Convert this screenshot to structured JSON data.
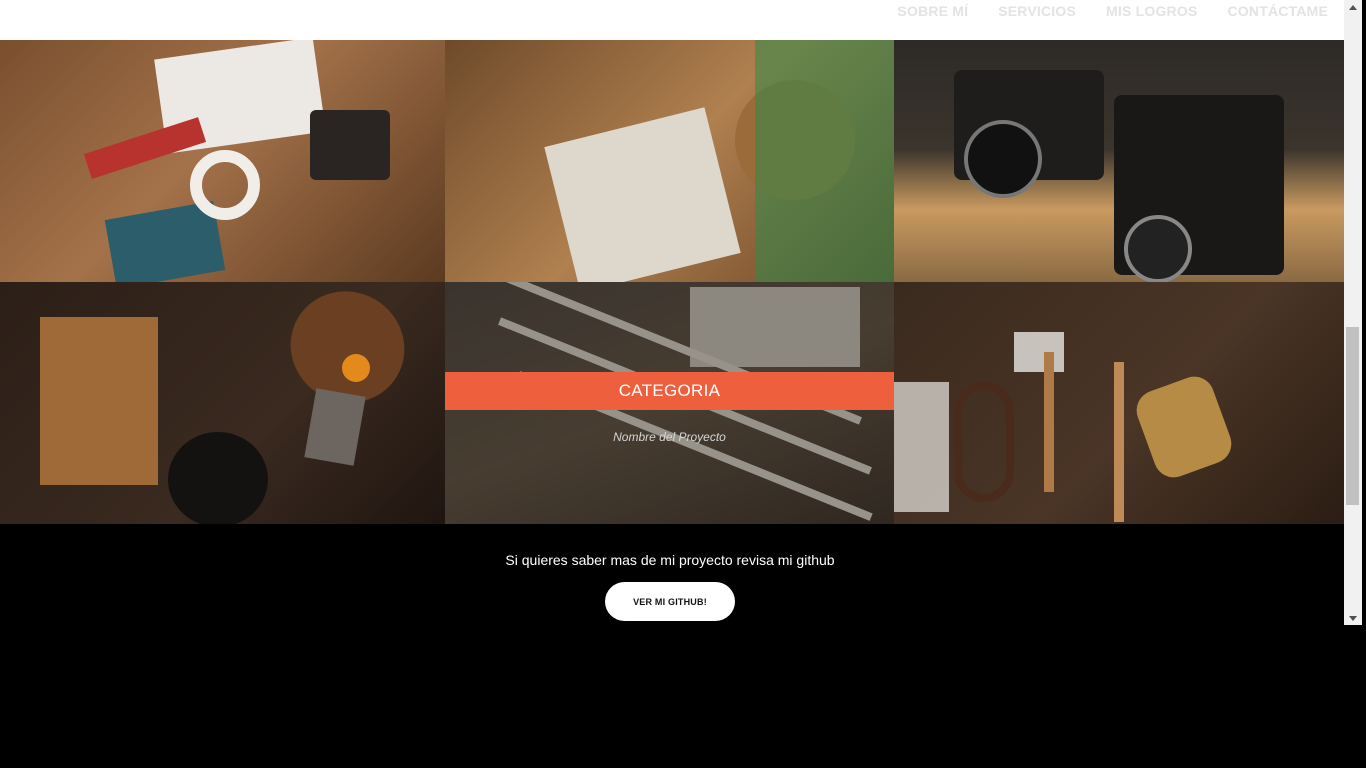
{
  "nav": {
    "links": [
      "SOBRE MÍ",
      "SERVICIOS",
      "MIS LOGROS",
      "CONTÁCTAME"
    ]
  },
  "portfolio": {
    "tiles": [
      {
        "scene": "design-desk"
      },
      {
        "scene": "notebooks"
      },
      {
        "scene": "cameras"
      },
      {
        "scene": "kitchen"
      },
      {
        "scene": "pencils"
      },
      {
        "scene": "tools"
      }
    ],
    "hover_tile": {
      "category": "CATEGORIA",
      "project_name": "Nombre del Proyecto"
    }
  },
  "cta": {
    "text": "Si quieres saber mas de mi proyecto revisa mi github",
    "button_label": "VER MI GITHUB!"
  },
  "colors": {
    "accent": "#ee5f3e",
    "nav_bg": "#ffffff",
    "footer_bg": "#000000"
  }
}
